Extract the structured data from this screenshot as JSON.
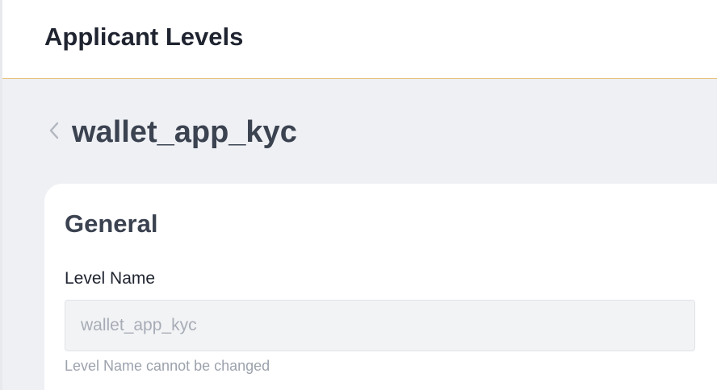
{
  "header": {
    "title": "Applicant Levels"
  },
  "page": {
    "back_icon": "chevron-left-icon",
    "title": "wallet_app_kyc"
  },
  "general_section": {
    "title": "General",
    "level_name": {
      "label": "Level Name",
      "value": "wallet_app_kyc",
      "disabled": true,
      "help": "Level Name cannot be changed"
    }
  },
  "colors": {
    "accent_border": "#e7c27a",
    "content_background": "#eef0f4",
    "heading_text": "#3b4250",
    "muted_text": "#9ca2ad"
  }
}
